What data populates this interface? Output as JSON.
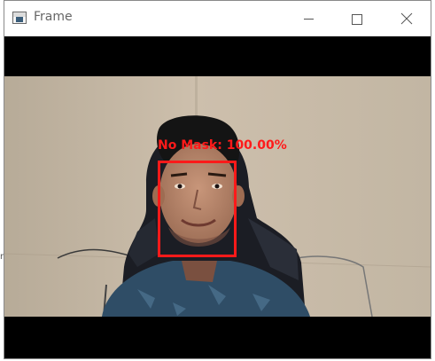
{
  "window": {
    "title": "Frame",
    "controls": {
      "minimize_icon": "minimize-icon",
      "maximize_icon": "maximize-icon",
      "close_icon": "close-icon"
    }
  },
  "video": {
    "detection": {
      "label": "No Mask: 100.00%",
      "box_color": "#ff1a1a"
    }
  },
  "colors": {
    "letterbox": "#000000",
    "titlebar_bg": "#ffffff",
    "detection": "#ff1a1a"
  }
}
